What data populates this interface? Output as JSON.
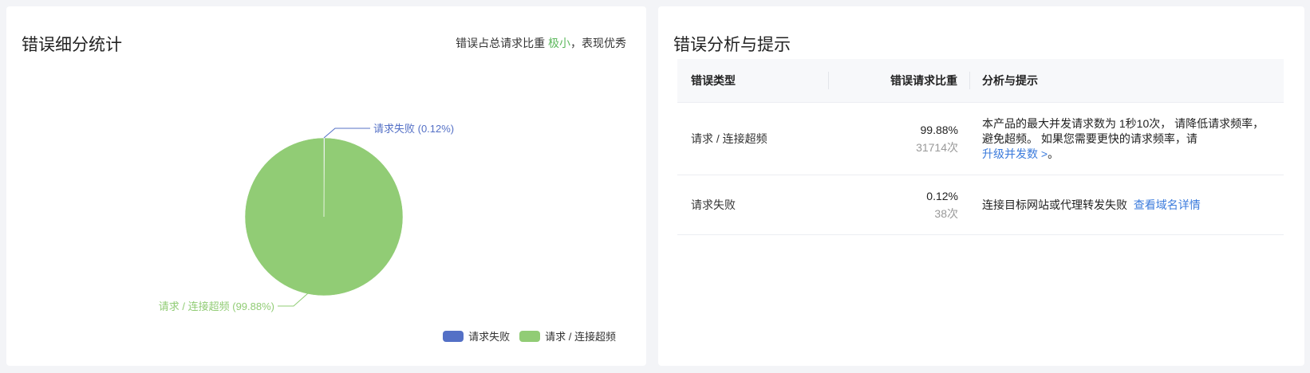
{
  "left_panel": {
    "title": "错误细分统计",
    "summary": {
      "prefix": "错误占总请求比重",
      "level": "极小",
      "suffix": "，表现优秀"
    }
  },
  "chart_data": {
    "type": "pie",
    "title": "",
    "series": [
      {
        "name": "请求失败",
        "value": 0.12,
        "label": "请求失败 (0.12%)",
        "color": "#5470c6"
      },
      {
        "name": "请求 / 连接超频",
        "value": 99.88,
        "label": "请求 / 连接超频 (99.88%)",
        "color": "#91cc75"
      }
    ],
    "legend": [
      "请求失败",
      "请求 / 连接超频"
    ],
    "legend_position": "bottom-right"
  },
  "right_panel": {
    "title": "错误分析与提示",
    "table": {
      "headers": [
        "错误类型",
        "错误请求比重",
        "分析与提示"
      ],
      "rows": [
        {
          "type": "请求 / 连接超频",
          "percent": "99.88%",
          "count": "31714次",
          "analysis": "本产品的最大并发请求数为 1秒10次， 请降低请求频率，避免超频。 如果您需要更快的请求频率，请",
          "link": "升级并发数 >",
          "after": "。"
        },
        {
          "type": "请求失败",
          "percent": "0.12%",
          "count": "38次",
          "analysis": "连接目标网站或代理转发失败",
          "link": "查看域名详情",
          "after": ""
        }
      ]
    }
  }
}
